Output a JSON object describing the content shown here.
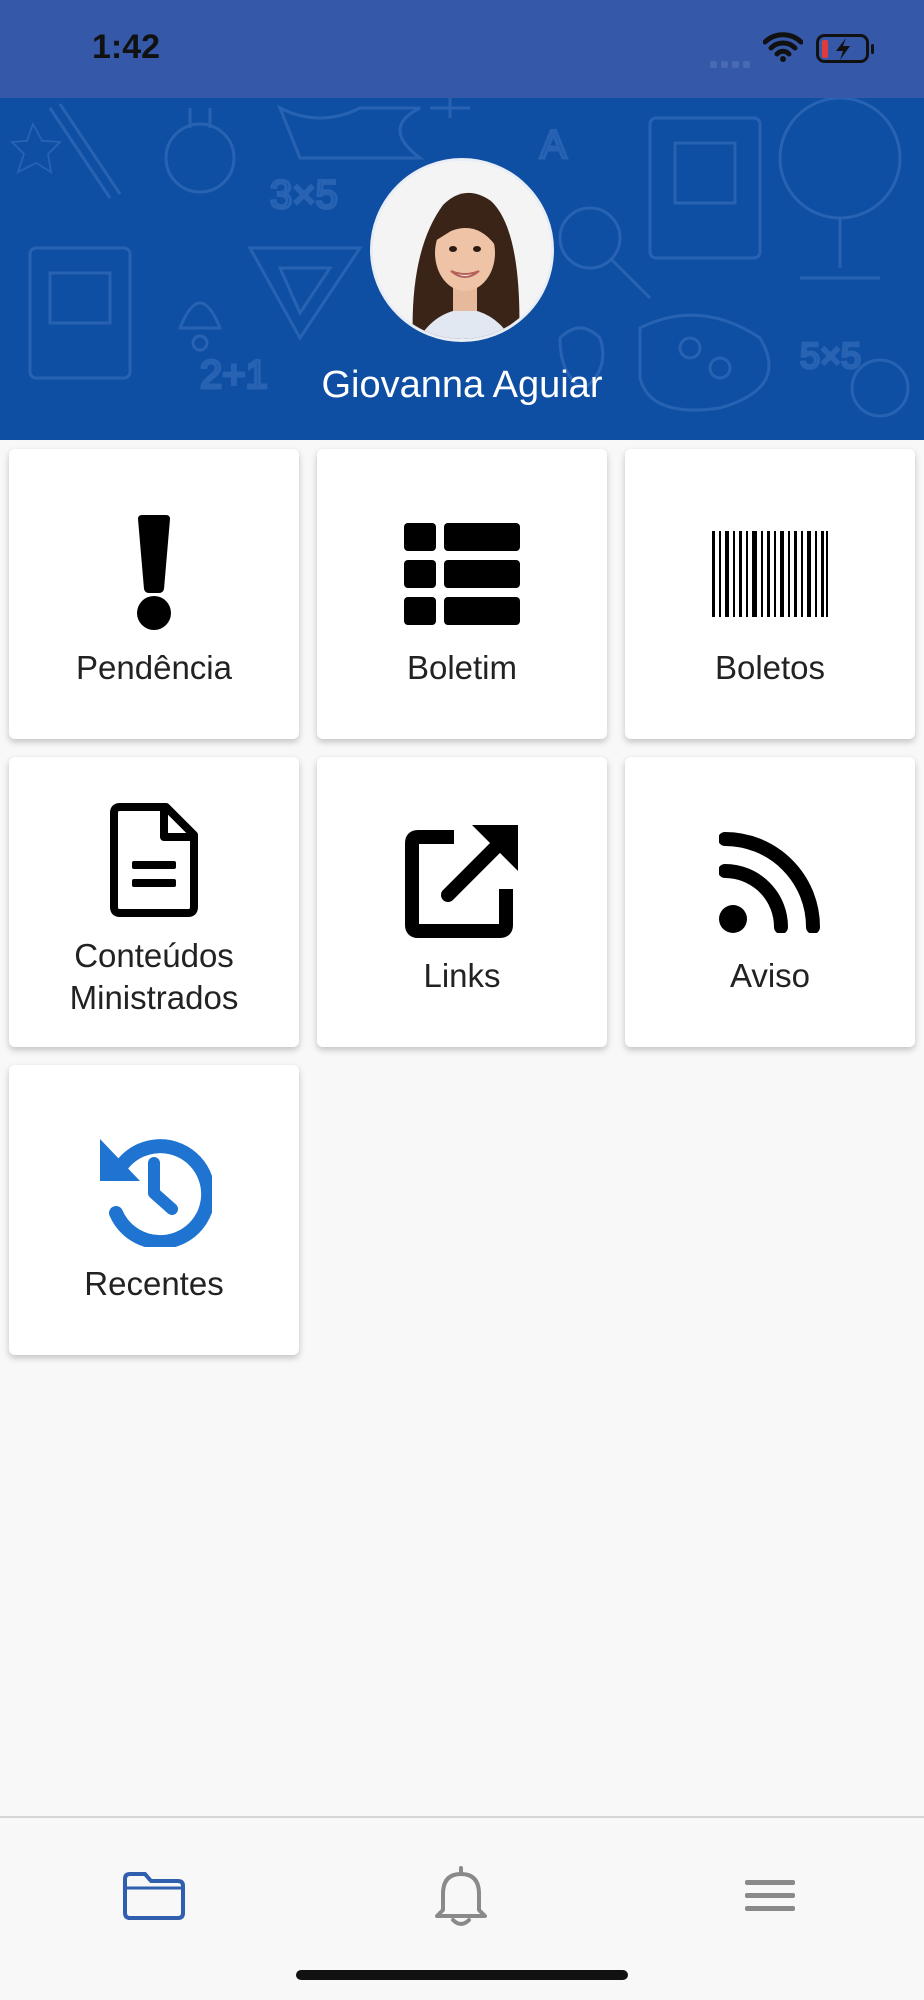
{
  "status_bar": {
    "time": "1:42",
    "icons": [
      "signal-icon",
      "wifi-icon",
      "battery-charging-icon"
    ],
    "background": "#3559a8"
  },
  "profile": {
    "name": "Giovanna Aguiar",
    "header_color": "#0f4fa3"
  },
  "menu": {
    "items": [
      {
        "label": "Pendência",
        "icon": "exclamation-icon"
      },
      {
        "label": "Boletim",
        "icon": "list-icon"
      },
      {
        "label": "Boletos",
        "icon": "barcode-icon"
      },
      {
        "label": "Conteúdos Ministrados",
        "icon": "document-icon"
      },
      {
        "label": "Links",
        "icon": "external-link-icon"
      },
      {
        "label": "Aviso",
        "icon": "rss-icon"
      },
      {
        "label": "Recentes",
        "icon": "history-icon"
      }
    ],
    "accent_color": "#1e74d0"
  },
  "bottom_nav": {
    "items": [
      {
        "icon": "folder-icon",
        "active": true
      },
      {
        "icon": "bell-icon",
        "active": false
      },
      {
        "icon": "menu-icon",
        "active": false
      }
    ],
    "active_color": "#2f5fae",
    "inactive_color": "#8a8a8a"
  }
}
